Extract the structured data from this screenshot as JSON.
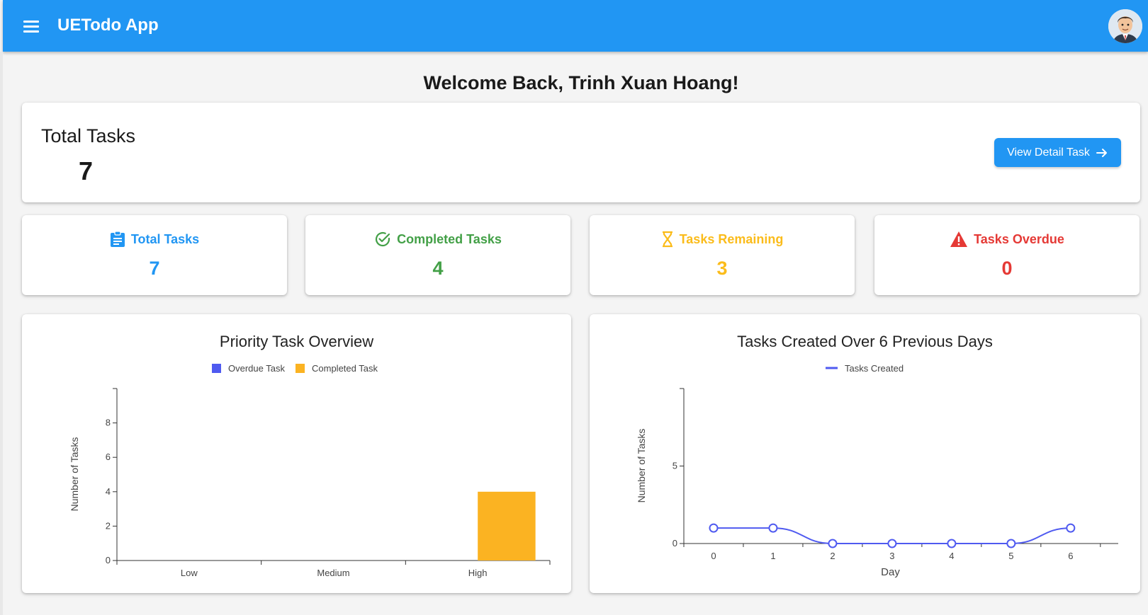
{
  "app": {
    "title": "UETodo App"
  },
  "welcome": "Welcome Back, Trinh Xuan Hoang!",
  "summary": {
    "title": "Total Tasks",
    "value": "7",
    "button_label": "View Detail Task"
  },
  "stats": [
    {
      "label": "Total Tasks",
      "value": "7",
      "color": "#2196f3",
      "icon": "clipboard-icon"
    },
    {
      "label": "Completed Tasks",
      "value": "4",
      "color": "#43a047",
      "icon": "check-circle-icon"
    },
    {
      "label": "Tasks Remaining",
      "value": "3",
      "color": "#fbbc1b",
      "icon": "hourglass-icon"
    },
    {
      "label": "Tasks Overdue",
      "value": "0",
      "color": "#e53935",
      "icon": "warning-icon"
    }
  ],
  "chart_data": [
    {
      "type": "bar",
      "title": "Priority Task Overview",
      "categories": [
        "Low",
        "Medium",
        "High"
      ],
      "series": [
        {
          "name": "Overdue Task",
          "color": "#4f5af0",
          "values": [
            0,
            0,
            0
          ]
        },
        {
          "name": "Completed Task",
          "color": "#fbb322",
          "values": [
            0,
            0,
            4
          ]
        }
      ],
      "ylabel": "Number of Tasks",
      "yticks": [
        "0",
        "2",
        "4",
        "6",
        "8"
      ],
      "ylim": [
        0,
        10
      ],
      "legend": "top-center",
      "grid": false
    },
    {
      "type": "line",
      "title": "Tasks Created Over 6 Previous Days",
      "x": [
        0,
        1,
        2,
        3,
        4,
        5,
        6
      ],
      "xticks": [
        "0",
        "1",
        "2",
        "3",
        "4",
        "5",
        "6"
      ],
      "series": [
        {
          "name": "Tasks Created",
          "color": "#4f5af0",
          "values": [
            1,
            1,
            0,
            0,
            0,
            0,
            1
          ]
        }
      ],
      "xlabel": "Day",
      "ylabel": "Number of Tasks",
      "yticks": [
        "0",
        "5"
      ],
      "ylim": [
        0,
        10
      ],
      "legend": "top-center",
      "grid": false
    }
  ]
}
